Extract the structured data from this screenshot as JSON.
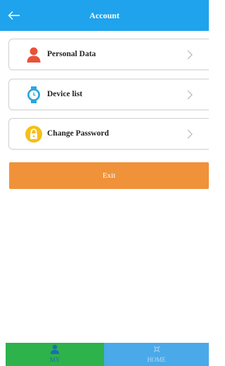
{
  "header": {
    "title": "Account",
    "back_icon": "back-arrow-icon",
    "background": "#1ea3ec"
  },
  "menu": {
    "items": [
      {
        "label": "Personal Data",
        "icon": "person-icon",
        "icon_color": "#e8523a"
      },
      {
        "label": "Device list",
        "icon": "watch-icon",
        "icon_color": "#2aa6e3"
      },
      {
        "label": "Change Password",
        "icon": "lock-icon",
        "icon_color": "#f5c015"
      }
    ],
    "chevron_icon": "chevron-right-icon"
  },
  "exit_button": {
    "label": "Exit",
    "background": "#f0923a"
  },
  "tabbar": {
    "tabs": [
      {
        "label": "MY",
        "icon": "user-icon",
        "active": true,
        "background": "#2db24c"
      },
      {
        "label": "HOME",
        "icon": "home-icon",
        "active": false,
        "background": "#4aa9e8"
      }
    ]
  }
}
